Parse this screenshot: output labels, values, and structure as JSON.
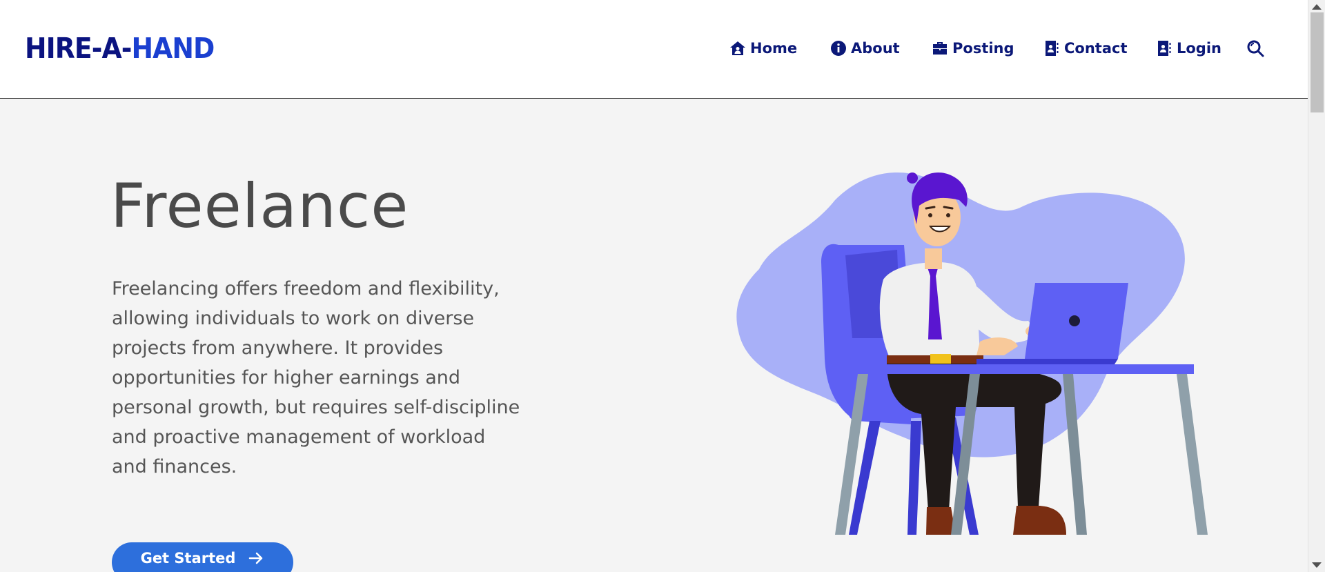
{
  "header": {
    "logo_part1": "HIRE-A-",
    "logo_part2": "HAND"
  },
  "nav": {
    "items": [
      {
        "label": "Home",
        "icon": "home-icon"
      },
      {
        "label": "About",
        "icon": "info-icon"
      },
      {
        "label": "Posting",
        "icon": "briefcase-icon"
      },
      {
        "label": "Contact",
        "icon": "contact-book-icon"
      },
      {
        "label": "Login",
        "icon": "contact-book-icon"
      }
    ],
    "search_icon": "search-icon"
  },
  "hero": {
    "title": "Freelance",
    "description": "Freelancing offers freedom and flexibility, allowing individuals to work on diverse projects from anywhere. It provides opportunities for higher earnings and personal growth, but requires self-discipline and proactive management of workload and finances.",
    "cta_label": "Get Started",
    "cta_icon": "arrow-right-icon"
  },
  "colors": {
    "logo_dark": "#0b1380",
    "logo_accent": "#1a3fd0",
    "nav_text": "#0b1878",
    "cta_bg": "#2d6fdc",
    "blob": "#a8b0f8",
    "chair": "#5a5cf0",
    "tie": "#5a16d0"
  }
}
